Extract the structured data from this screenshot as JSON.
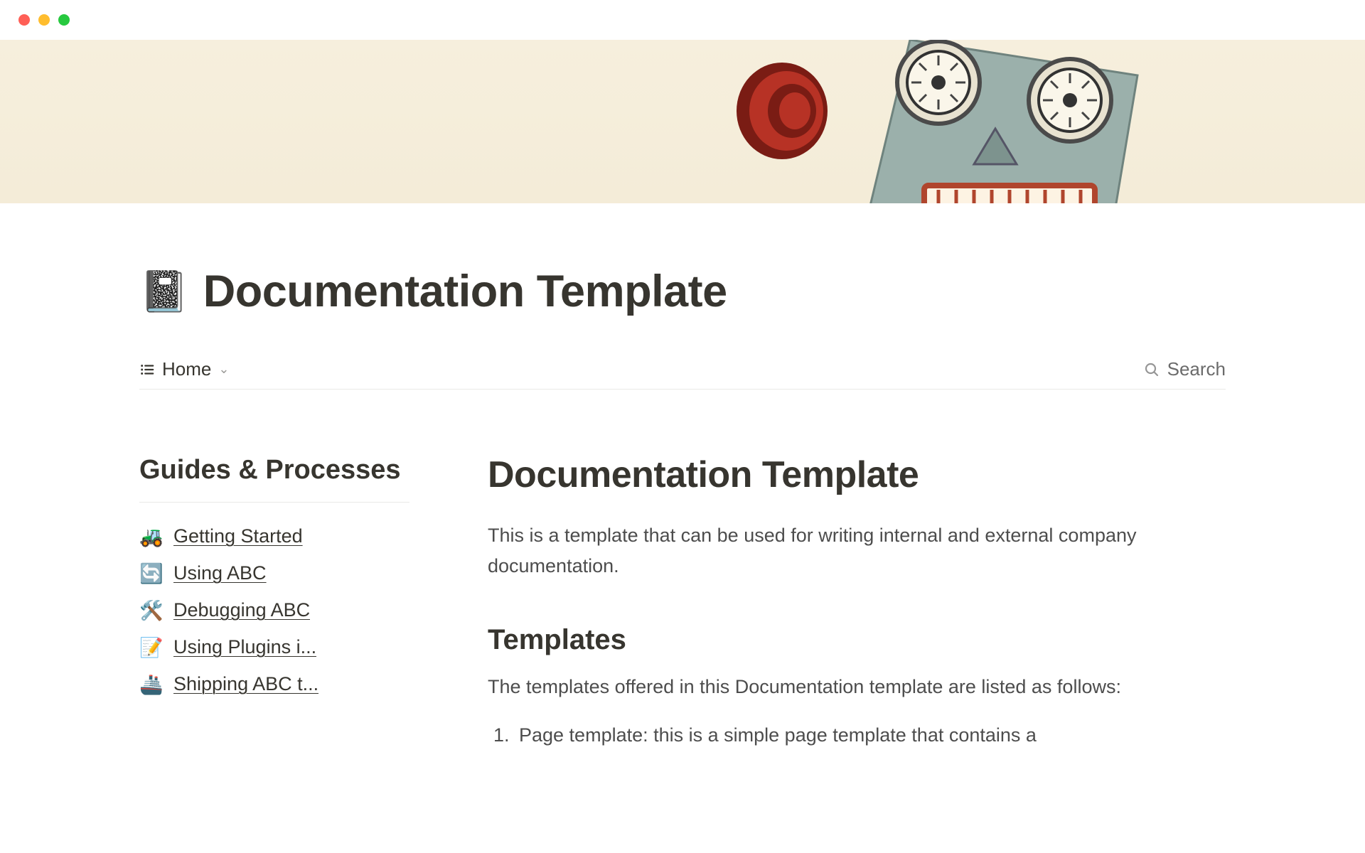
{
  "titlebar": {
    "red": "",
    "yellow": "",
    "green": ""
  },
  "header": {
    "icon": "📓",
    "title": "Documentation Template"
  },
  "toolbar": {
    "list_icon": "☰",
    "crumb": "Home",
    "chevron": "⌄",
    "search_label": "Search"
  },
  "sidebar": {
    "heading": "Guides & Processes",
    "items": [
      {
        "emoji": "🚜",
        "label": "Getting Started"
      },
      {
        "emoji": "🔄",
        "label": "Using ABC"
      },
      {
        "emoji": "🛠️",
        "label": "Debugging ABC"
      },
      {
        "emoji": "📝",
        "label": "Using Plugins i..."
      },
      {
        "emoji": "🚢",
        "label": "Shipping ABC t..."
      }
    ]
  },
  "main": {
    "h1": "Documentation Template",
    "intro": "This is a template that can be used for writing internal and external company documentation.",
    "sub": "Templates",
    "body": "The templates offered in this Documentation template are listed as follows:",
    "ol": [
      "Page template: this is a simple page template that contains a"
    ]
  }
}
